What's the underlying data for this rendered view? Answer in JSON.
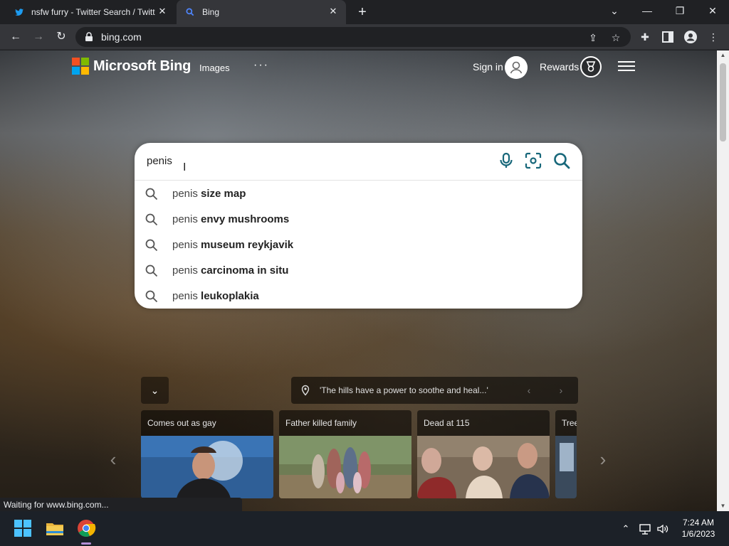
{
  "browser": {
    "tabs": [
      {
        "title": "nsfw furry - Twitter Search / Twitt",
        "icon": "twitter-icon"
      },
      {
        "title": "Bing",
        "icon": "bing-search-icon"
      }
    ],
    "url": "bing.com"
  },
  "bing": {
    "brand": "Microsoft Bing",
    "nav_images": "Images",
    "nav_more": "···",
    "sign_in": "Sign in",
    "rewards": "Rewards"
  },
  "search": {
    "query": "penis",
    "suggestions": [
      {
        "prefix": "penis ",
        "bold": "size map"
      },
      {
        "prefix": "penis ",
        "bold": "envy mushrooms"
      },
      {
        "prefix": "penis ",
        "bold": "museum reykjavik"
      },
      {
        "prefix": "penis ",
        "bold": "carcinoma in situ"
      },
      {
        "prefix": "penis ",
        "bold": "leukoplakia"
      }
    ]
  },
  "background": {
    "caption": "'The hills have a power to soothe and heal...'"
  },
  "cards": [
    {
      "title": "Comes out as gay"
    },
    {
      "title": "Father killed family"
    },
    {
      "title": "Dead at 115"
    },
    {
      "title": "Tree"
    }
  ],
  "status_text": "Waiting for www.bing.com...",
  "taskbar": {
    "time": "7:24 AM",
    "date": "1/6/2023"
  },
  "colors": {
    "ms_red": "#f25022",
    "ms_green": "#7fba00",
    "ms_blue": "#00a4ef",
    "ms_yellow": "#ffb900",
    "bing_accent": "#17677a"
  }
}
